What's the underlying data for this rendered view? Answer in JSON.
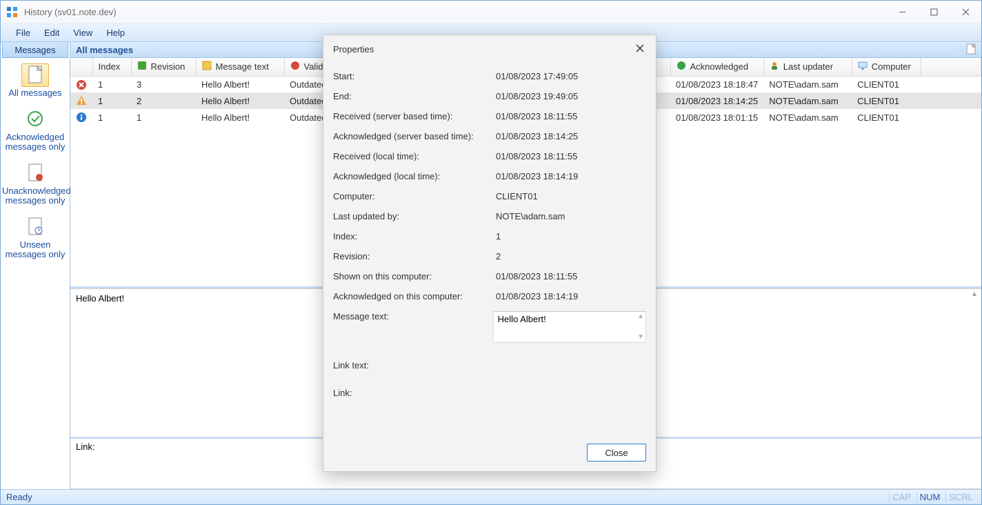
{
  "window": {
    "title": "History (sv01.note.dev)"
  },
  "menubar": [
    "File",
    "Edit",
    "View",
    "Help"
  ],
  "sidebar": {
    "tab": "Messages",
    "items": [
      {
        "label": "All messages",
        "selected": true
      },
      {
        "label": "Acknowledged messages only",
        "selected": false
      },
      {
        "label": "Unacknowledged messages only",
        "selected": false
      },
      {
        "label": "Unseen messages only",
        "selected": false
      }
    ]
  },
  "header": {
    "title": "All messages"
  },
  "columns": [
    "Index",
    "Revision",
    "Message text",
    "Validity",
    "Acknowledged",
    "Last updater",
    "Computer"
  ],
  "rows": [
    {
      "icon": "error",
      "index": "1",
      "revision": "3",
      "text": "Hello Albert!",
      "validity": "Outdated",
      "ack": "01/08/2023 18:18:47",
      "updater": "NOTE\\adam.sam",
      "computer": "CLIENT01",
      "sel": false
    },
    {
      "icon": "warn",
      "index": "1",
      "revision": "2",
      "text": "Hello Albert!",
      "validity": "Outdated",
      "ack": "01/08/2023 18:14:25",
      "updater": "NOTE\\adam.sam",
      "computer": "CLIENT01",
      "sel": true
    },
    {
      "icon": "info",
      "index": "1",
      "revision": "1",
      "text": "Hello Albert!",
      "validity": "Outdated",
      "ack": "01/08/2023 18:01:15",
      "updater": "NOTE\\adam.sam",
      "computer": "CLIENT01",
      "sel": false
    }
  ],
  "preview": {
    "text": "Hello Albert!"
  },
  "link_label": "Link:",
  "status": {
    "ready": "Ready",
    "cap": "CAP",
    "num": "NUM",
    "scrl": "SCRL"
  },
  "dialog": {
    "title": "Properties",
    "close": "Close",
    "msgtext": "Hello Albert!",
    "rows": [
      {
        "k": "Start:",
        "v": "01/08/2023 17:49:05"
      },
      {
        "k": "End:",
        "v": "01/08/2023 19:49:05"
      },
      {
        "k": "Received (server based time):",
        "v": "01/08/2023 18:11:55"
      },
      {
        "k": "Acknowledged (server based time):",
        "v": "01/08/2023 18:14:25"
      },
      {
        "k": "Received (local time):",
        "v": "01/08/2023 18:11:55"
      },
      {
        "k": "Acknowledged (local time):",
        "v": "01/08/2023 18:14:19"
      },
      {
        "k": "Computer:",
        "v": "CLIENT01"
      },
      {
        "k": "Last updated by:",
        "v": "NOTE\\adam.sam"
      },
      {
        "k": "Index:",
        "v": "1"
      },
      {
        "k": "Revision:",
        "v": "2"
      },
      {
        "k": "Shown on this computer:",
        "v": "01/08/2023 18:11:55"
      },
      {
        "k": "Acknowledged on this computer:",
        "v": "01/08/2023 18:14:19"
      }
    ],
    "link_text_label": "Link text:",
    "link_label": "Link:",
    "msg_label": "Message text:"
  }
}
